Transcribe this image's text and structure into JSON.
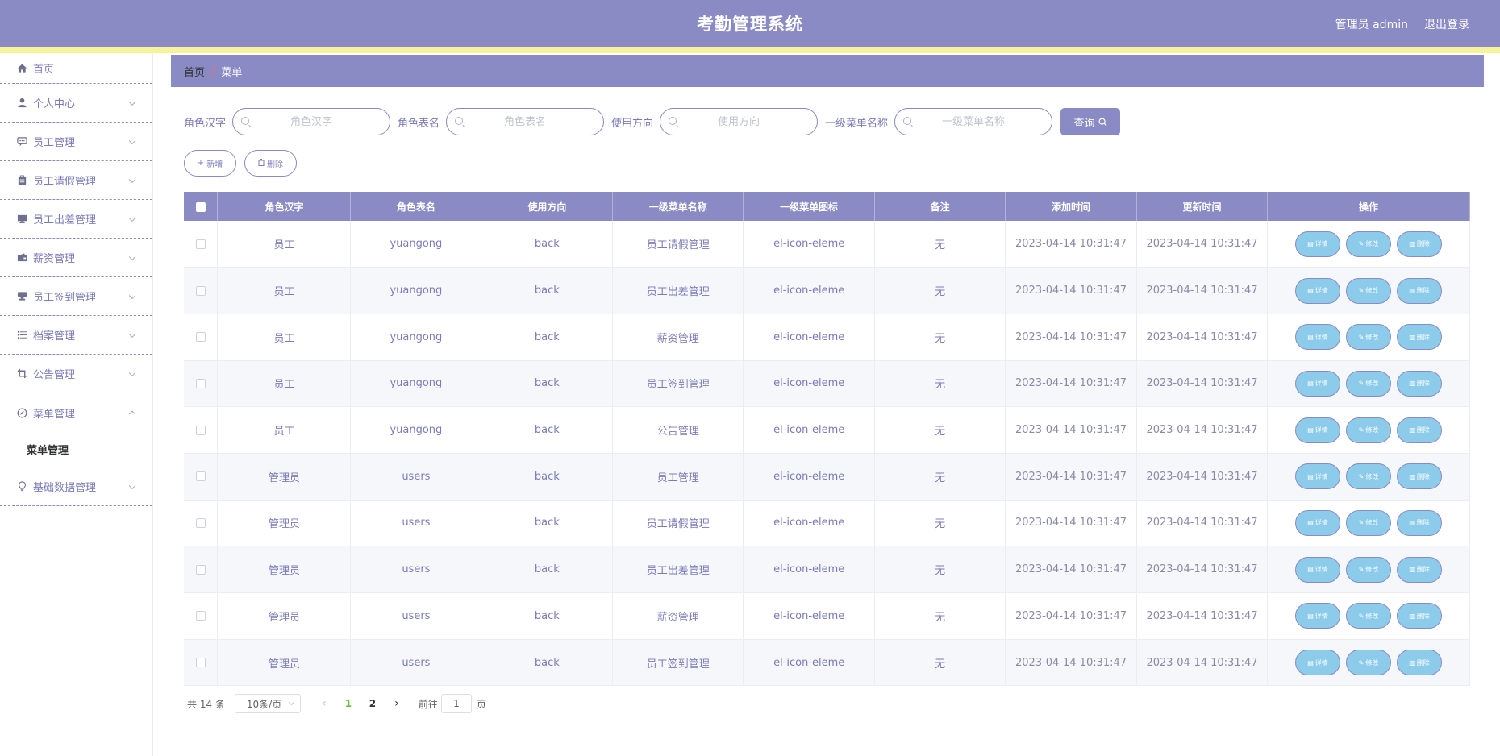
{
  "header": {
    "title": "考勤管理系统",
    "user_label": "管理员 admin",
    "logout_label": "退出登录"
  },
  "sidebar": {
    "items": [
      {
        "label": "首页",
        "icon": "home-icon"
      },
      {
        "label": "个人中心",
        "icon": "user-icon"
      },
      {
        "label": "员工管理",
        "icon": "chat-icon"
      },
      {
        "label": "员工请假管理",
        "icon": "clipboard-icon"
      },
      {
        "label": "员工出差管理",
        "icon": "monitor-icon"
      },
      {
        "label": "薪资管理",
        "icon": "wallet-icon"
      },
      {
        "label": "员工签到管理",
        "icon": "stamp-icon"
      },
      {
        "label": "档案管理",
        "icon": "list-icon"
      },
      {
        "label": "公告管理",
        "icon": "crop-icon"
      },
      {
        "label": "菜单管理",
        "icon": "compass-icon"
      },
      {
        "label": "基础数据管理",
        "icon": "bulb-icon"
      }
    ],
    "submenu": {
      "label": "菜单管理"
    }
  },
  "breadcrumb": {
    "home": "首页",
    "separator": "/",
    "current": "菜单"
  },
  "search": {
    "fields": [
      {
        "label": "角色汉字",
        "placeholder": "角色汉字"
      },
      {
        "label": "角色表名",
        "placeholder": "角色表名"
      },
      {
        "label": "使用方向",
        "placeholder": "使用方向"
      },
      {
        "label": "一级菜单名称",
        "placeholder": "一级菜单名称"
      }
    ],
    "query_label": "查询"
  },
  "actions": {
    "add_label": "新增",
    "delete_label": "删除"
  },
  "table": {
    "columns": [
      "角色汉字",
      "角色表名",
      "使用方向",
      "一级菜单名称",
      "一级菜单图标",
      "备注",
      "添加时间",
      "更新时间",
      "操作"
    ],
    "rows": [
      {
        "role": "员工",
        "table_name": "yuangong",
        "direction": "back",
        "menu": "员工请假管理",
        "menu_icon": "el-icon-eleme",
        "note": "无",
        "created": "2023-04-14 10:31:47",
        "updated": "2023-04-14 10:31:47"
      },
      {
        "role": "员工",
        "table_name": "yuangong",
        "direction": "back",
        "menu": "员工出差管理",
        "menu_icon": "el-icon-eleme",
        "note": "无",
        "created": "2023-04-14 10:31:47",
        "updated": "2023-04-14 10:31:47"
      },
      {
        "role": "员工",
        "table_name": "yuangong",
        "direction": "back",
        "menu": "薪资管理",
        "menu_icon": "el-icon-eleme",
        "note": "无",
        "created": "2023-04-14 10:31:47",
        "updated": "2023-04-14 10:31:47"
      },
      {
        "role": "员工",
        "table_name": "yuangong",
        "direction": "back",
        "menu": "员工签到管理",
        "menu_icon": "el-icon-eleme",
        "note": "无",
        "created": "2023-04-14 10:31:47",
        "updated": "2023-04-14 10:31:47"
      },
      {
        "role": "员工",
        "table_name": "yuangong",
        "direction": "back",
        "menu": "公告管理",
        "menu_icon": "el-icon-eleme",
        "note": "无",
        "created": "2023-04-14 10:31:47",
        "updated": "2023-04-14 10:31:47"
      },
      {
        "role": "管理员",
        "table_name": "users",
        "direction": "back",
        "menu": "员工管理",
        "menu_icon": "el-icon-eleme",
        "note": "无",
        "created": "2023-04-14 10:31:47",
        "updated": "2023-04-14 10:31:47"
      },
      {
        "role": "管理员",
        "table_name": "users",
        "direction": "back",
        "menu": "员工请假管理",
        "menu_icon": "el-icon-eleme",
        "note": "无",
        "created": "2023-04-14 10:31:47",
        "updated": "2023-04-14 10:31:47"
      },
      {
        "role": "管理员",
        "table_name": "users",
        "direction": "back",
        "menu": "员工出差管理",
        "menu_icon": "el-icon-eleme",
        "note": "无",
        "created": "2023-04-14 10:31:47",
        "updated": "2023-04-14 10:31:47"
      },
      {
        "role": "管理员",
        "table_name": "users",
        "direction": "back",
        "menu": "薪资管理",
        "menu_icon": "el-icon-eleme",
        "note": "无",
        "created": "2023-04-14 10:31:47",
        "updated": "2023-04-14 10:31:47"
      },
      {
        "role": "管理员",
        "table_name": "users",
        "direction": "back",
        "menu": "员工签到管理",
        "menu_icon": "el-icon-eleme",
        "note": "无",
        "created": "2023-04-14 10:31:47",
        "updated": "2023-04-14 10:31:47"
      }
    ],
    "row_actions": {
      "detail": "详情",
      "edit": "修改",
      "delete": "删除"
    }
  },
  "pagination": {
    "total_text": "共 14 条",
    "page_size": "10条/页",
    "pages": [
      "1",
      "2"
    ],
    "current_page": "1",
    "goto_label": "前往",
    "goto_value": "1",
    "page_unit": "页"
  },
  "colors": {
    "primary": "#8a8ac4",
    "header_stripe": "#f7f39a",
    "op_button": "#8dcbea",
    "active_page": "#67c23a"
  }
}
